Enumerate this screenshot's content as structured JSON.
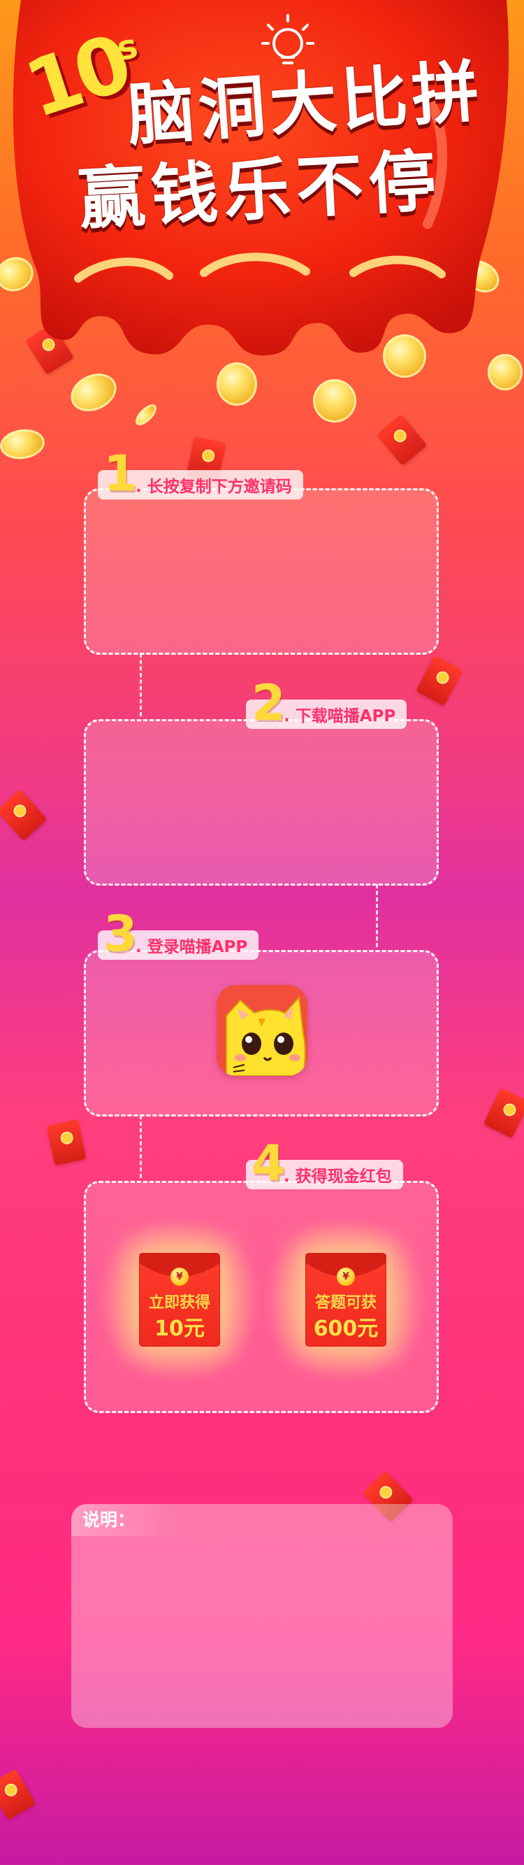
{
  "hero": {
    "ten": "10",
    "ten_suffix": "s",
    "title_line1": "脑洞大比拼",
    "title_line2": "赢钱乐不停"
  },
  "steps": [
    {
      "num": "1",
      "label": ". 长按复制下方邀请码"
    },
    {
      "num": "2",
      "label": ". 下载喵播APP"
    },
    {
      "num": "3",
      "label": ". 登录喵播APP"
    },
    {
      "num": "4",
      "label": ". 获得现金红包"
    }
  ],
  "rewards": [
    {
      "line1": "立即获得",
      "line2": "10元",
      "coin": "¥"
    },
    {
      "line1": "答题可获",
      "line2": "600元",
      "coin": "¥"
    }
  ],
  "note": {
    "title": "说明："
  },
  "colors": {
    "accent": "#ff2f6a",
    "gold": "#ffd83a",
    "red": "#ef2a1e"
  },
  "icons": [
    "lightbulb-icon",
    "coin-icon",
    "red-packet-icon",
    "cat-app-icon"
  ]
}
